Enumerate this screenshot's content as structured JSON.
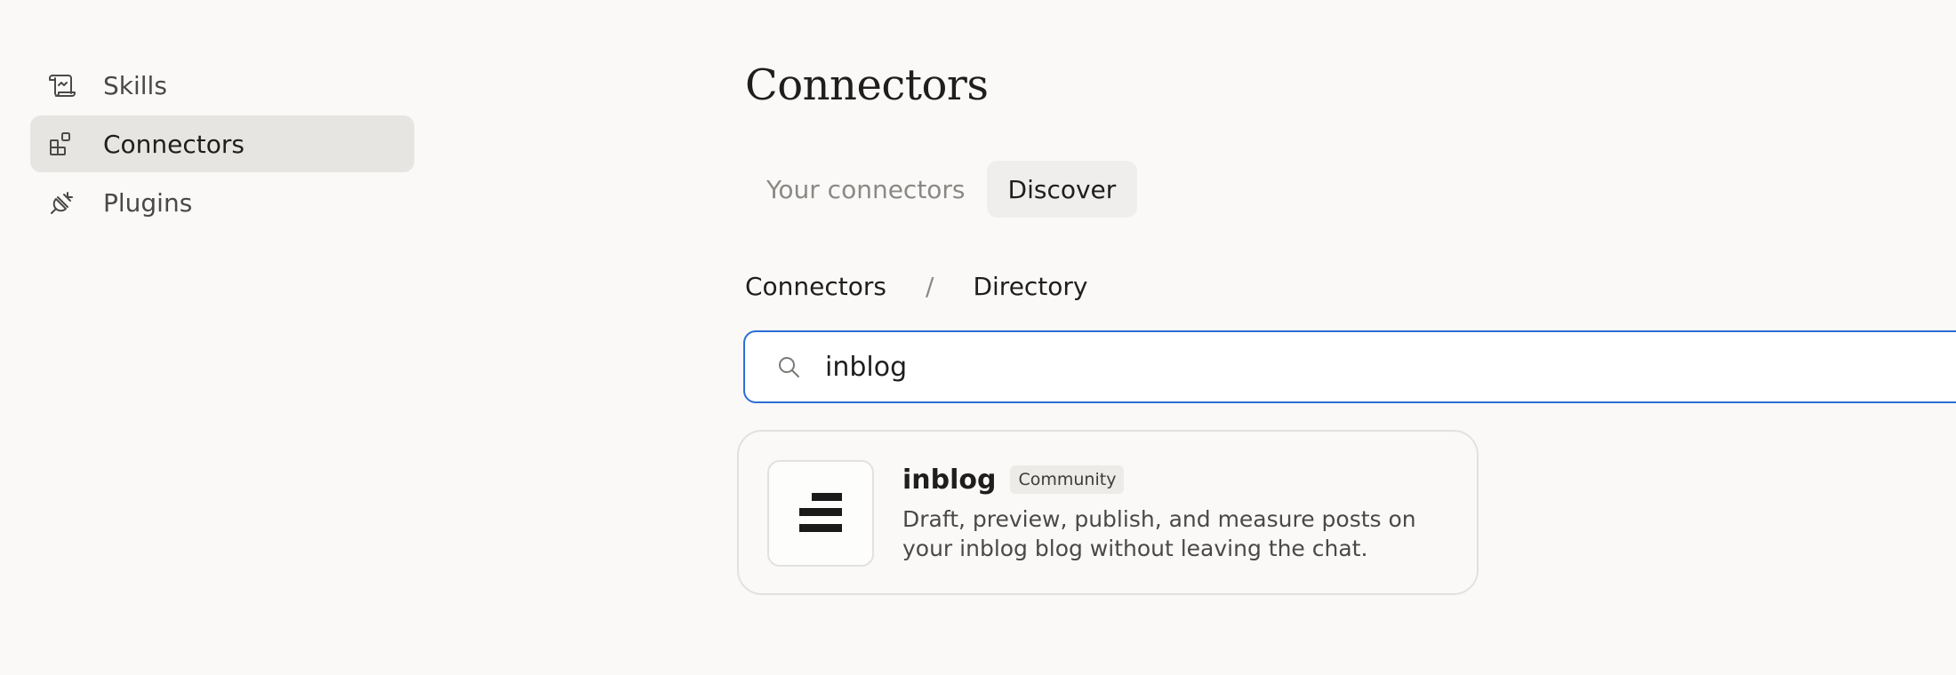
{
  "sidebar": {
    "items": [
      {
        "label": "Skills",
        "icon": "scroll-icon",
        "active": false
      },
      {
        "label": "Connectors",
        "icon": "grid-blocks-icon",
        "active": true
      },
      {
        "label": "Plugins",
        "icon": "plug-icon",
        "active": false
      }
    ]
  },
  "main": {
    "title": "Connectors",
    "tabs": [
      {
        "label": "Your connectors",
        "active": false
      },
      {
        "label": "Discover",
        "active": true
      }
    ],
    "breadcrumb": {
      "parent": "Connectors",
      "separator": "/",
      "current": "Directory"
    },
    "search": {
      "value": "inblog",
      "icon": "search-icon"
    },
    "results": [
      {
        "name": "inblog",
        "badge": "Community",
        "description": "Draft, preview, publish, and measure posts on your inblog blog without leaving the chat.",
        "logo": "inblog-logo"
      }
    ]
  },
  "colors": {
    "background": "#faf9f7",
    "active_nav": "#e6e5e2",
    "focus_ring": "#2c6ed6",
    "text": "#1f1e1d",
    "muted_text": "#8a8985"
  }
}
